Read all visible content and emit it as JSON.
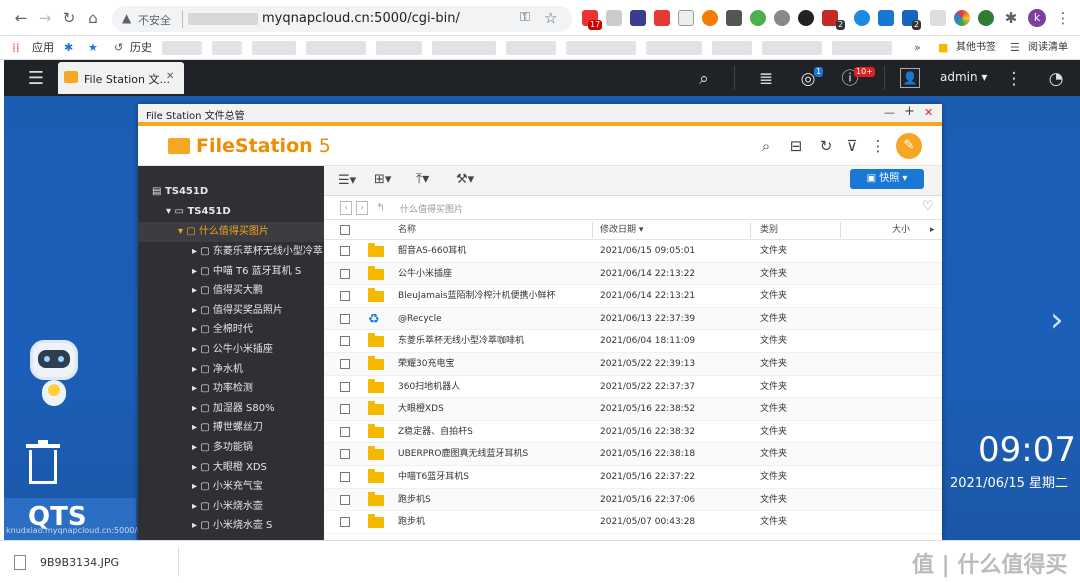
{
  "browser": {
    "insecure_label": "不安全",
    "url": "myqnapcloud.cn:5000/cgi-bin/",
    "ext_badges": [
      "17",
      "2",
      "2"
    ],
    "bookmarks": {
      "apps": "应用",
      "history": "历史",
      "other": "其他书签",
      "reading_list": "阅读清单",
      "more": "»"
    },
    "profile_initial": "k"
  },
  "qnap_bar": {
    "tab_title": "File Station 文...",
    "tab_close": "✕",
    "user": "admin ▾",
    "notif_badge_1": "1",
    "notif_badge_2": "10+"
  },
  "desktop": {
    "qts_label": "QTS",
    "clock": "09:07",
    "date": "2021/06/15 星期二",
    "status_url": "knudxiao.myqnapcloud.cn:5000/cgi-bin/#"
  },
  "window": {
    "title": "File Station 文件总管",
    "controls": {
      "min": "—",
      "max": "+",
      "close": "✕"
    },
    "app_name_bold": "FileStation",
    "app_version": " 5",
    "snapshot_label": "快照 ▾",
    "path_placeholder": "什么值得买图片"
  },
  "tree": {
    "root": "TS451D",
    "volume": "TS451D",
    "selected": "什么值得买图片",
    "items": [
      "东菱乐萃杯无线小型冷萃",
      "中喵 T6 蓝牙耳机 S",
      "值得买大鹏",
      "值得买奖品照片",
      "全棉时代",
      "公牛小米插座",
      "净水机",
      "功率检测",
      "加湿器 S80%",
      "搏世螺丝刀",
      "多功能锅",
      "大眼橙 XDS",
      "小米充气宝",
      "小米烧水壶",
      "小米烧水壶 S"
    ]
  },
  "table": {
    "headers": {
      "name": "名称",
      "date": "修改日期 ▾",
      "type": "类别",
      "size": "大小"
    },
    "rows": [
      {
        "name": "韶音AS-660耳机",
        "date": "2021/06/15 09:05:01",
        "type": "文件夹",
        "icon": "folder"
      },
      {
        "name": "公牛小米插座",
        "date": "2021/06/14 22:13:22",
        "type": "文件夹",
        "icon": "folder"
      },
      {
        "name": "BleuJamais蓝陌制冷榨汁机便携小鲜杯",
        "date": "2021/06/14 22:13:21",
        "type": "文件夹",
        "icon": "folder"
      },
      {
        "name": "@Recycle",
        "date": "2021/06/13 22:37:39",
        "type": "文件夹",
        "icon": "recycle"
      },
      {
        "name": "东菱乐萃杯无线小型冷萃咖啡机",
        "date": "2021/06/04 18:11:09",
        "type": "文件夹",
        "icon": "folder"
      },
      {
        "name": "荣耀30充电宝",
        "date": "2021/05/22 22:39:13",
        "type": "文件夹",
        "icon": "folder"
      },
      {
        "name": "360扫地机器人",
        "date": "2021/05/22 22:37:37",
        "type": "文件夹",
        "icon": "folder"
      },
      {
        "name": "大眼橙XDS",
        "date": "2021/05/16 22:38:52",
        "type": "文件夹",
        "icon": "folder"
      },
      {
        "name": "Z稳定器、自拍杆S",
        "date": "2021/05/16 22:38:32",
        "type": "文件夹",
        "icon": "folder"
      },
      {
        "name": "UBERPRO鹿图真无线蓝牙耳机S",
        "date": "2021/05/16 22:38:18",
        "type": "文件夹",
        "icon": "folder"
      },
      {
        "name": "中喵T6蓝牙耳机S",
        "date": "2021/05/16 22:37:22",
        "type": "文件夹",
        "icon": "folder"
      },
      {
        "name": "跑步机S",
        "date": "2021/05/16 22:37:06",
        "type": "文件夹",
        "icon": "folder"
      },
      {
        "name": "跑步机",
        "date": "2021/05/07 00:43:28",
        "type": "文件夹",
        "icon": "folder"
      }
    ]
  },
  "download_bar": {
    "file": "9B9B3134.JPG"
  },
  "watermark": {
    "text": "值 | 什么值得买"
  }
}
